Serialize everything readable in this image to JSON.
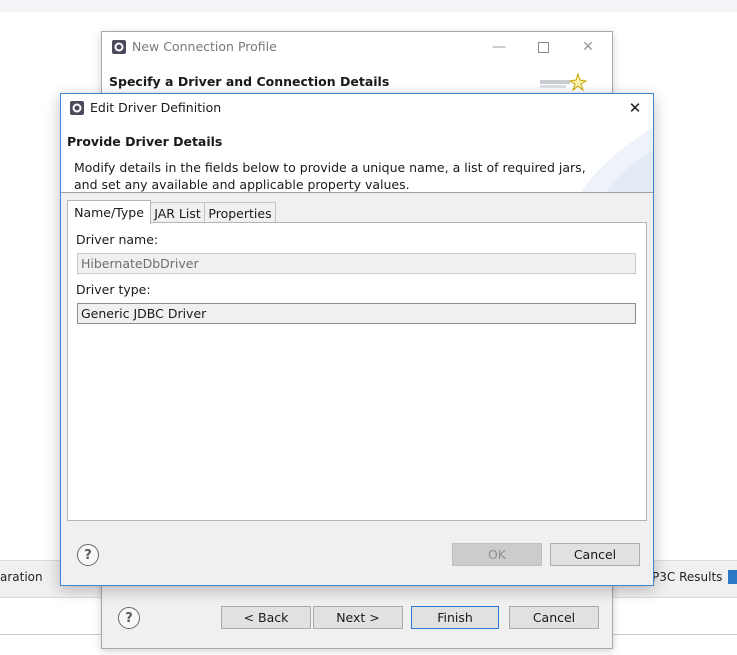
{
  "background": {
    "left_text": "aration",
    "right_text": "P3C Results"
  },
  "back_dialog": {
    "title": "New Connection Profile",
    "header": "Specify a Driver and Connection Details",
    "buttons": {
      "back": "< Back",
      "next": "Next >",
      "finish": "Finish",
      "cancel": "Cancel"
    }
  },
  "front_dialog": {
    "title": "Edit Driver Definition",
    "header": "Provide Driver Details",
    "description_line1": "Modify details in the fields below to provide a unique name, a list of required jars,",
    "description_line2": "and set any available and applicable property values.",
    "tabs": [
      {
        "label": "Name/Type",
        "active": true
      },
      {
        "label": "JAR List",
        "active": false
      },
      {
        "label": "Properties",
        "active": false
      }
    ],
    "driver_name_label": "Driver name:",
    "driver_name_value": "HibernateDbDriver",
    "driver_type_label": "Driver type:",
    "driver_type_value": "Generic JDBC Driver",
    "buttons": {
      "ok": "OK",
      "cancel": "Cancel"
    }
  },
  "colors": {
    "accent_border": "#3c86d1",
    "default_button_border": "#2d7ad6",
    "dialog_bg": "#f0f0f0"
  },
  "icons": [
    "eclipse-app-icon",
    "minimize-icon",
    "maximize-icon",
    "close-icon",
    "help-icon",
    "wizard-star-icon"
  ]
}
